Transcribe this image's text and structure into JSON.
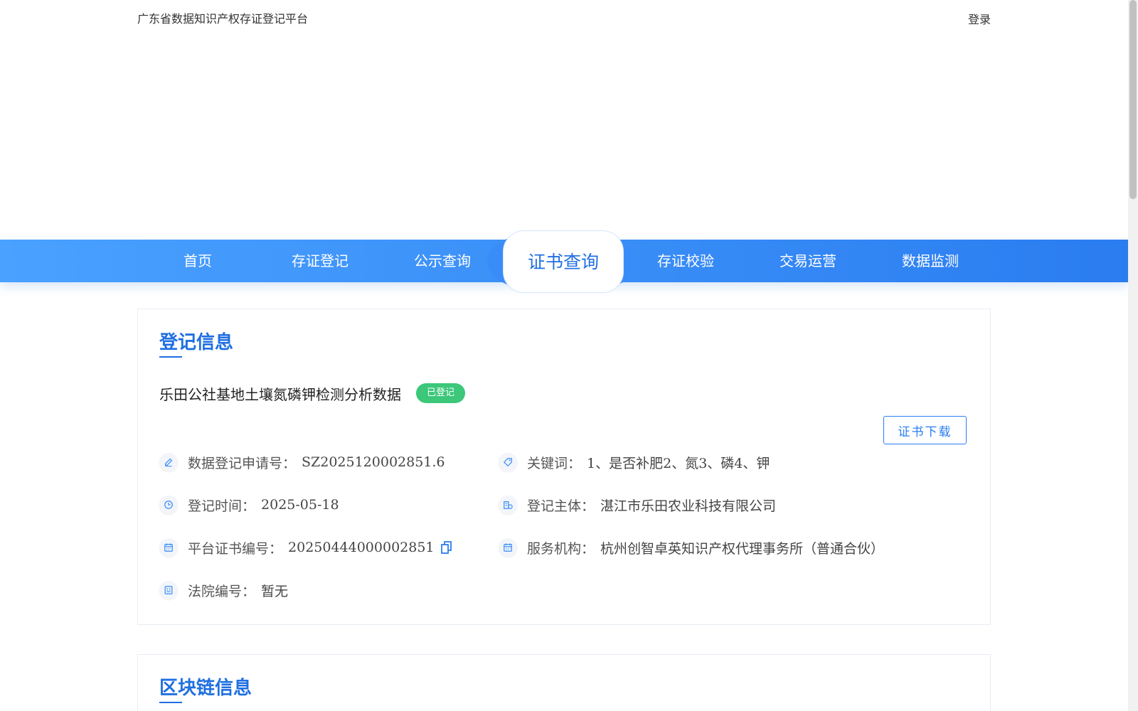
{
  "header": {
    "site_title": "广东省数据知识产权存证登记平台",
    "login_label": "登录"
  },
  "nav": {
    "items": [
      "首页",
      "存证登记",
      "公示查询",
      "证书查询",
      "存证校验",
      "交易运营",
      "数据监测"
    ],
    "active": "证书查询"
  },
  "registration": {
    "heading": "登记信息",
    "data_name": "乐田公社基地土壤氮磷钾检测分析数据",
    "status": "已登记",
    "download_label": "证书下载",
    "fields": {
      "application_no": {
        "label": "数据登记申请号：",
        "value": "SZ2025120002851.6"
      },
      "keywords": {
        "label": "关键词：",
        "value": "1、是否补肥2、氮3、磷4、钾"
      },
      "reg_time": {
        "label": "登记时间：",
        "value": "2025-05-18"
      },
      "subject": {
        "label": "登记主体：",
        "value": "湛江市乐田农业科技有限公司"
      },
      "cert_no": {
        "label": "平台证书编号：",
        "value": "20250444000002851"
      },
      "agency": {
        "label": "服务机构：",
        "value": "杭州创智卓英知识产权代理事务所（普通合伙）"
      },
      "court_no": {
        "label": "法院编号：",
        "value": "暂无"
      }
    }
  },
  "blockchain": {
    "heading": "区块链信息"
  },
  "icons": {
    "application_no": "edit-icon",
    "keywords": "tag-icon",
    "reg_time": "clock-icon",
    "subject": "building-icon",
    "cert_no": "calendar-icon",
    "agency": "calendar-icon",
    "court_no": "document-icon",
    "copy": "copy-icon"
  },
  "colors": {
    "accent": "#1f6fe0",
    "nav_gradient_start": "#4aa1ff",
    "nav_gradient_end": "#2b7df0",
    "status_green": "#3cc77a"
  }
}
